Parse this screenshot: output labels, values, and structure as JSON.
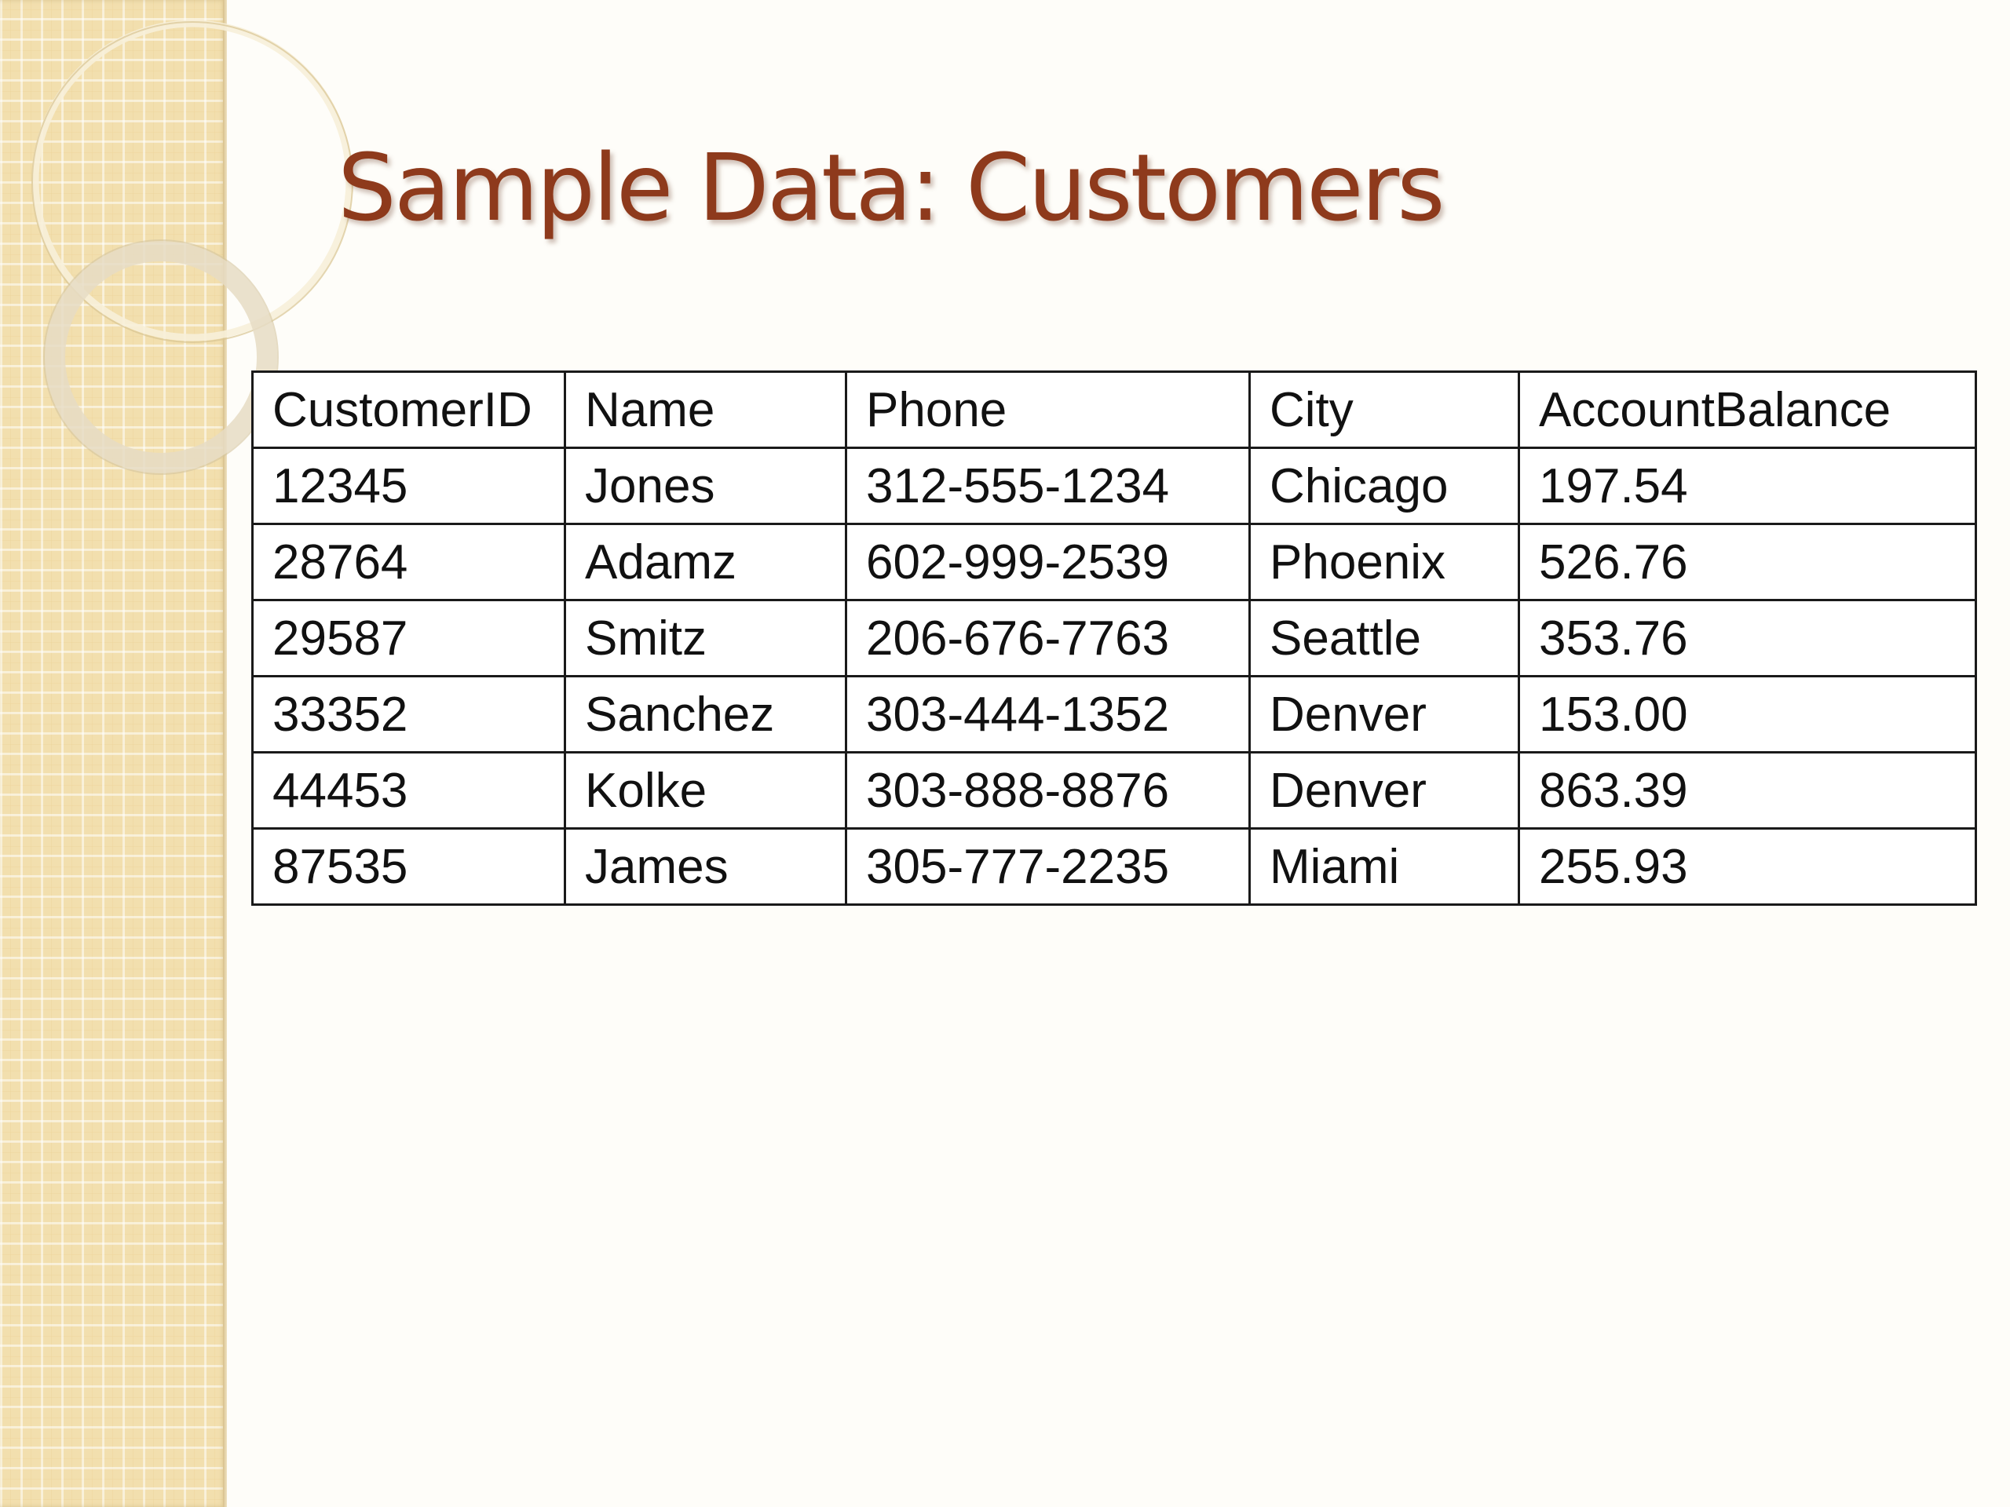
{
  "slide": {
    "title": "Sample Data: Customers"
  },
  "table": {
    "headers": [
      "CustomerID",
      "Name",
      "Phone",
      "City",
      "AccountBalance"
    ],
    "rows": [
      [
        "12345",
        "Jones",
        "312-555-1234",
        "Chicago",
        "197.54"
      ],
      [
        "28764",
        "Adamz",
        "602-999-2539",
        "Phoenix",
        "526.76"
      ],
      [
        "29587",
        "Smitz",
        "206-676-7763",
        "Seattle",
        "353.76"
      ],
      [
        "33352",
        "Sanchez",
        "303-444-1352",
        "Denver",
        "153.00"
      ],
      [
        "44453",
        "Kolke",
        "303-888-8876",
        "Denver",
        "863.39"
      ],
      [
        "87535",
        "James",
        "305-777-2235",
        "Miami",
        "255.93"
      ]
    ]
  },
  "colors": {
    "title": "#8e3a1c",
    "side_band": "#f2dfae",
    "background": "#fefdf9",
    "table_border": "#1a1a1a"
  }
}
